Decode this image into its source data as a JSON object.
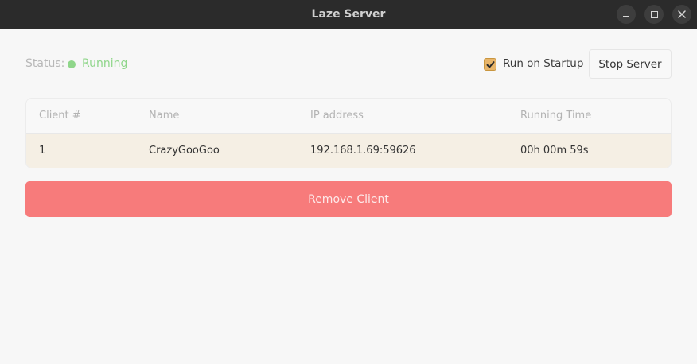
{
  "window": {
    "title": "Laze Server"
  },
  "status": {
    "label": "Status:",
    "value": "Running",
    "color": "#8fd68a"
  },
  "startup": {
    "label": "Run on Startup",
    "checked": true
  },
  "toolbar": {
    "stop_label": "Stop Server"
  },
  "table": {
    "headers": [
      "Client #",
      "Name",
      "IP address",
      "Running Time"
    ],
    "rows": [
      [
        "1",
        "CrazyGooGoo",
        "192.168.1.69:59626",
        "00h 00m 59s"
      ]
    ]
  },
  "actions": {
    "remove_label": "Remove Client",
    "remove_color": "#f77b7b"
  },
  "icons": {
    "minimize": "minimize-icon",
    "maximize": "maximize-icon",
    "close": "close-icon",
    "check": "check-icon",
    "status": "status-dot-icon"
  }
}
